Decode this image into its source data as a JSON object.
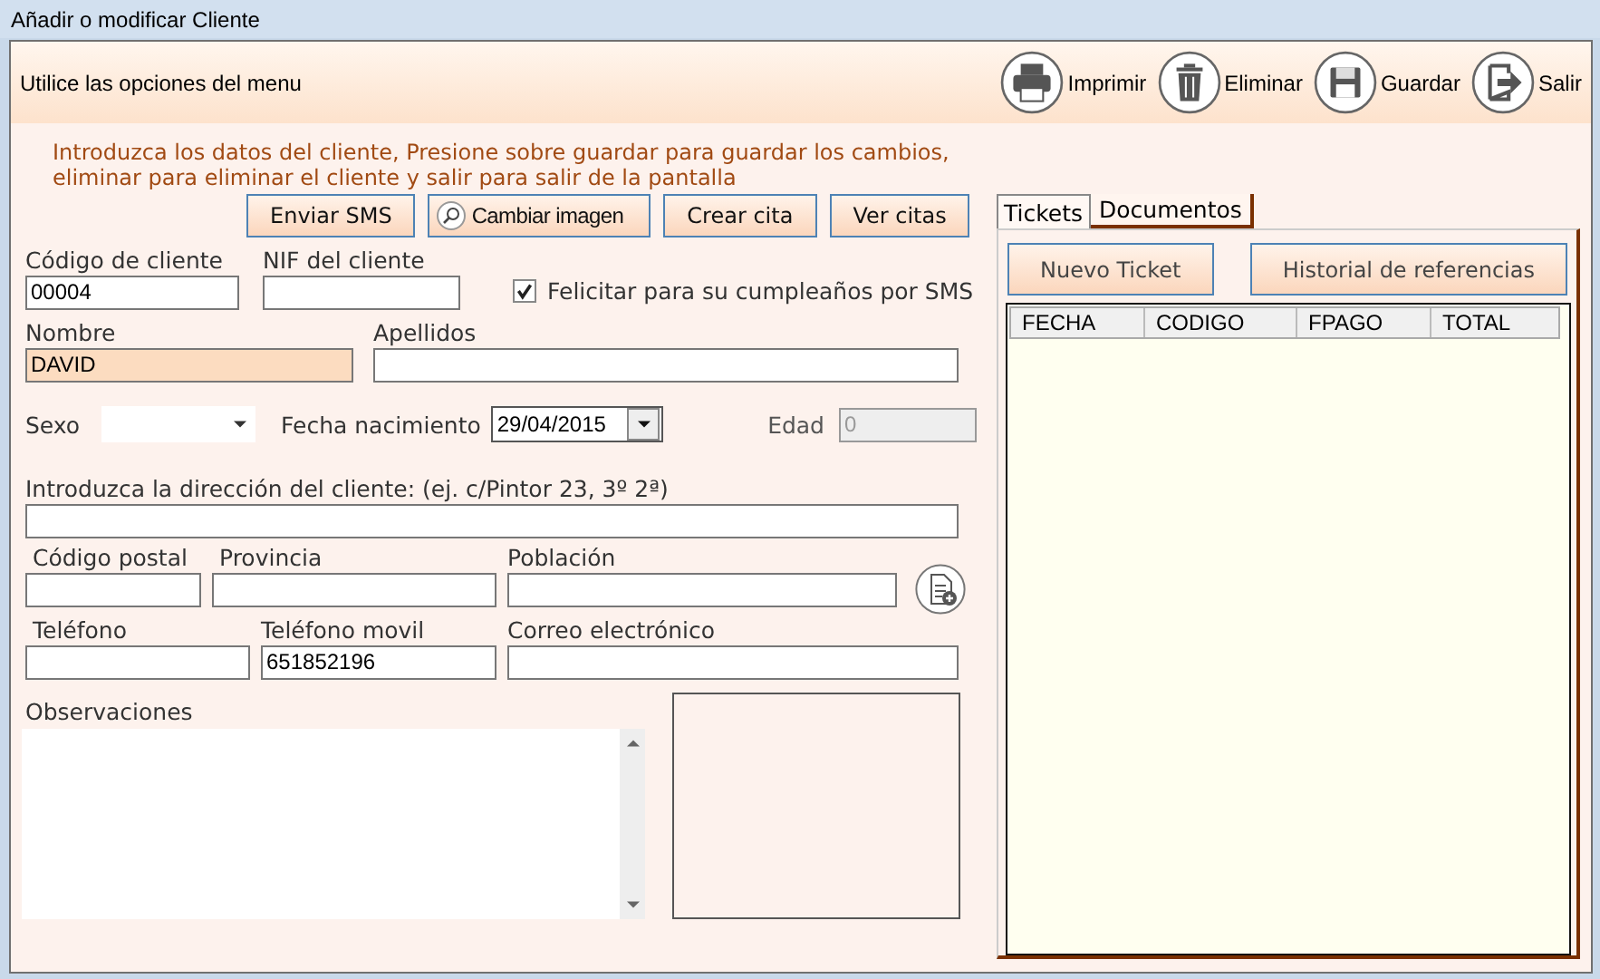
{
  "window": {
    "title": "Añadir o modificar Cliente"
  },
  "toolbar": {
    "hint": "Utilice las opciones del menu",
    "buttons": [
      {
        "label": "Imprimir",
        "kind": "print"
      },
      {
        "label": "Eliminar",
        "kind": "delete"
      },
      {
        "label": "Guardar",
        "kind": "save"
      },
      {
        "label": "Salir",
        "kind": "exit"
      }
    ]
  },
  "instructions": "Introduzca los datos del cliente, Presione sobre guardar para guardar los cambios, eliminar para eliminar el cliente y salir para salir de la pantalla",
  "action_buttons": [
    {
      "label": "Enviar SMS",
      "kind": "plain"
    },
    {
      "label": "Cambiar imagen",
      "kind": "search"
    },
    {
      "label": "Crear cita",
      "kind": "plain"
    },
    {
      "label": "Ver citas",
      "kind": "plain"
    }
  ],
  "form": {
    "codigo": {
      "label": "Código de cliente",
      "value": "00004"
    },
    "nif": {
      "label": "NIF del cliente"
    },
    "felicitar": {
      "label": "Felicitar para su cumpleaños por SMS",
      "checked": true
    },
    "nombre": {
      "label": "Nombre",
      "value": "DAVID",
      "highlighted": true
    },
    "apellidos": {
      "label": "Apellidos"
    },
    "sexo": {
      "label": "Sexo"
    },
    "fecha": {
      "label": "Fecha nacimiento",
      "value": "29/04/2015"
    },
    "edad": {
      "label": "Edad",
      "value": "0",
      "disabled": true
    },
    "direccion": {
      "label": "Introduzca la dirección del cliente: (ej. c/Pintor 23, 3º 2ª)"
    },
    "codigo_postal": {
      "label": "Código postal"
    },
    "provincia": {
      "label": "Provincia"
    },
    "poblacion": {
      "label": "Población"
    },
    "telefono": {
      "label": "Teléfono"
    },
    "movil": {
      "label": "Teléfono movil",
      "value": "651852196"
    },
    "correo": {
      "label": "Correo electrónico"
    },
    "observaciones": {
      "label": "Observaciones"
    }
  },
  "tabs": [
    {
      "label": "Tickets",
      "selected": true
    },
    {
      "label": "Documentos",
      "selected": false
    }
  ],
  "ticket_buttons": [
    "Nuevo Ticket",
    "Historial de referencias"
  ],
  "table": {
    "columns": [
      "FECHA",
      "CODIGO",
      "FPAGO",
      "TOTAL"
    ]
  }
}
